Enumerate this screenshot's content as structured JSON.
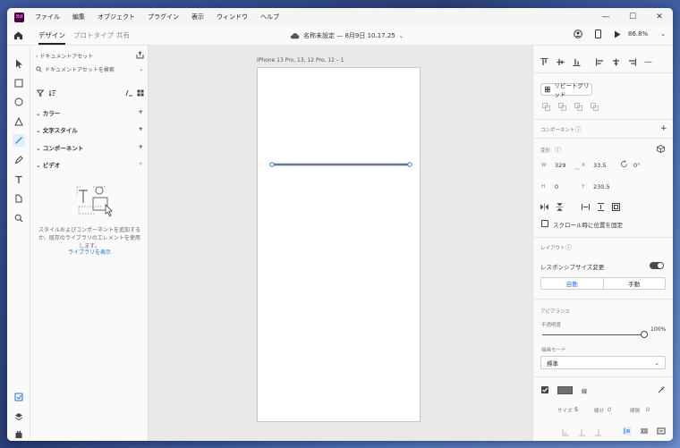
{
  "app": {
    "logo": "Xd"
  },
  "menu": [
    "ファイル",
    "編集",
    "オブジェクト",
    "プラグイン",
    "表示",
    "ウィンドウ",
    "ヘルプ"
  ],
  "window_controls": {
    "minimize": "—",
    "maximize": "☐",
    "close": "✕"
  },
  "tabs": [
    "デザイン",
    "プロトタイプ",
    "共有"
  ],
  "doc_title": "名称未設定 — 8月9日 10.17.25",
  "zoom": "86.8%",
  "assets": {
    "header": "ドキュメントアセット",
    "search_placeholder": "ドキュメントアセットを検索",
    "sections": [
      "カラー",
      "文字スタイル",
      "コンポーネント",
      "ビデオ"
    ],
    "empty_text": "スタイルおよびコンポーネントを追加するか、既存のライブラリのエレメントを使用します。",
    "library_link": "ライブラリを表示"
  },
  "artboard": {
    "label": "iPhone 13 Pro, 13, 12 Pro, 12 – 1"
  },
  "properties": {
    "repeat_grid": "リピートグリッド",
    "component_label": "コンポーネント",
    "transform_label": "変形",
    "W_label": "W",
    "W": "329",
    "X_label": "X",
    "X": "33.5",
    "rotation": "0°",
    "H_label": "H",
    "H": "0",
    "Y_label": "Y",
    "Y": "230.5",
    "fix_scroll": "スクロール時に位置を固定",
    "layout_label": "レイアウト",
    "responsive": "レスポンシブサイズ変更",
    "auto": "自動",
    "manual": "手動",
    "appearance_label": "アピアランス",
    "opacity_label": "不透明度",
    "opacity": "100%",
    "opacity_value": 1.0,
    "blend_label": "描画モード",
    "blend": "標準",
    "border_label": "線",
    "size_label": "サイズ",
    "size": "5",
    "dash_label": "線分",
    "dash": "0",
    "gap_label": "間隔",
    "gap": "0",
    "stroke_color": "#707070"
  },
  "accent": "#1473e6"
}
